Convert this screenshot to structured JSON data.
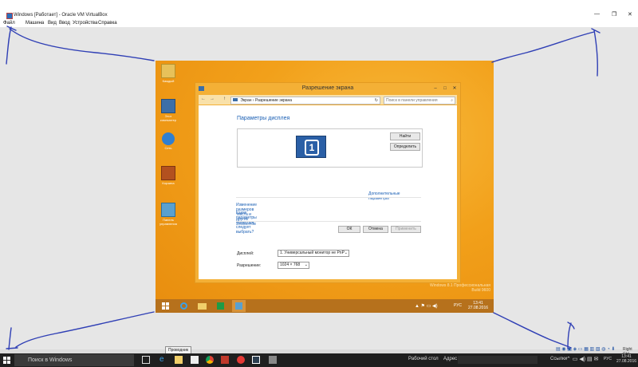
{
  "host_window": {
    "title": "Windows [Работает] - Oracle VM VirtualBox",
    "menu": [
      "Файл",
      "Машина",
      "Вид",
      "Ввод",
      "Устройства",
      "Справка"
    ],
    "controls": [
      "—",
      "❐",
      "✕"
    ],
    "host_key": "Right Ctrl"
  },
  "guest_desktop": {
    "icons": [
      "Каждый",
      "Этот компьютер",
      "Сеть",
      "Корзина",
      "Панель управления"
    ],
    "watermark": [
      "Windows 8.1 Профессиональная",
      "Build 9600"
    ],
    "taskbar": {
      "lang": "РУС",
      "time": "13:41",
      "date": "27.08.2016"
    }
  },
  "screen_resolution_window": {
    "title": "Разрешение экрана",
    "nav": {
      "back": "←",
      "forward": "→",
      "up": "↑"
    },
    "breadcrumb": [
      "Экран",
      "Разрешение экрана"
    ],
    "search_placeholder": "Поиск в панели управления",
    "heading": "Параметры дисплея",
    "monitor_number": "1",
    "find_button": "Найти",
    "identify_button": "Определить",
    "display_label": "Дисплей:",
    "display_value": "1. Универсальный монитор не PnP",
    "resolution_label": "Разрешение:",
    "resolution_value": "1024 × 768",
    "advanced_link": "Дополнительные параметры",
    "link1": "Изменение размеров текста и других элементов",
    "link2": "Какие параметры монитора следует выбрать?",
    "ok_button": "ОК",
    "cancel_button": "Отмена",
    "apply_button": "Применить"
  },
  "host_taskbar": {
    "search_placeholder": "Поиск в Windows",
    "tooltip": "Проводник",
    "desktop_label": "Рабочий стол",
    "address_label": "Адрес",
    "links_label": "Ссылки",
    "lang": "РУС",
    "time": "13:41",
    "date": "27.08.2016"
  },
  "colors": {
    "guest_bg": "#f2a01a",
    "window_frame": "#f4b036",
    "link": "#1a5fb4",
    "annotation": "#2f3fb5",
    "host_taskbar": "#1f1f1f"
  }
}
